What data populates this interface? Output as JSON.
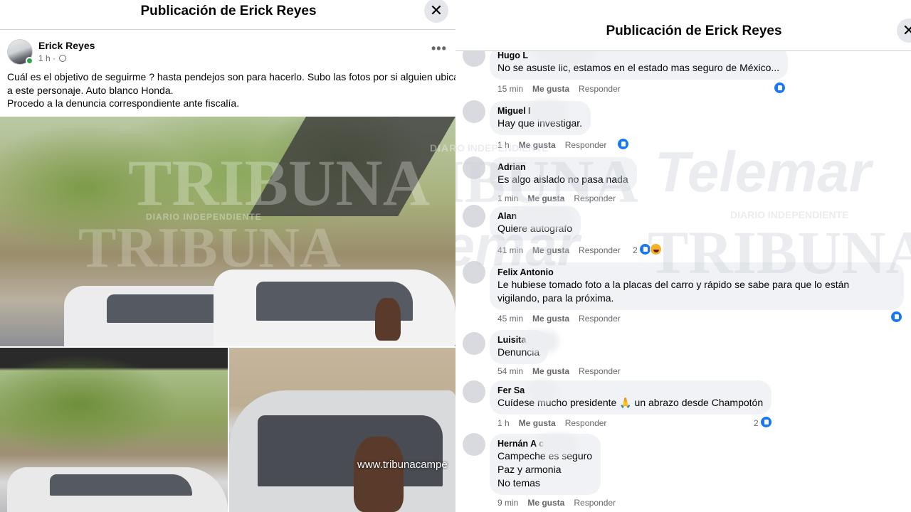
{
  "left_panel": {
    "title": "Publicación de Erick Reyes",
    "close_symbol": "✕",
    "author": "Erick Reyes",
    "time": "1 h",
    "time_separator": "·",
    "more_symbol": "•••",
    "post_lines": [
      "Cuál es el objetivo de seguirme ? hasta pendejos son para hacerlo. Subo las fotos por si alguien ubica",
      "a este personaje. Auto blanco Honda.",
      "Procedo a la denuncia correspondiente ante fiscalía."
    ],
    "watermark_main": "TRIBUNA",
    "watermark_sub": "DIARIO INDEPENDIENTE",
    "watermark_small": "DIARIO INDEPENDIENTE",
    "photo_credit": "www.tribunacampe"
  },
  "right_panel": {
    "title": "Publicación de Erick Reyes",
    "close_symbol": "✕",
    "watermarks": {
      "telemar_1": "Telemar",
      "telemar_2": "Telemar",
      "tribuna_1": "TRIBUNA",
      "tribuna_2": "TRIBUNA",
      "sub_1": "DIARIO INDEPENDIENTE",
      "sub_2": "DIARIO INDEPENDIENTE"
    },
    "comments": [
      {
        "name": "Hugo L",
        "lines": [
          "No se asuste lic, estamos en el estado mas seguro de México..."
        ],
        "time": "15 min",
        "like": "Me gusta",
        "reply": "Responder",
        "reactions": ""
      },
      {
        "name": "Miguel I",
        "lines": [
          "Hay que investigar."
        ],
        "time": "1 h",
        "like": "Me gusta",
        "reply": "Responder",
        "reactions": ""
      },
      {
        "name": "Adrian",
        "lines": [
          "Es algo aislado no pasa nada"
        ],
        "time": "1 min",
        "like": "Me gusta",
        "reply": "Responder",
        "reactions": ""
      },
      {
        "name": "Alan",
        "lines": [
          "Quiere autografo"
        ],
        "time": "41 min",
        "like": "Me gusta",
        "reply": "Responder",
        "reactions": "2"
      },
      {
        "name": "Felix Antonio",
        "lines": [
          "Le hubiese tomado foto a la placas del carro y rápido se sabe para que lo están",
          "vigilando, para la próxima."
        ],
        "time": "45 min",
        "like": "Me gusta",
        "reply": "Responder",
        "reactions": ""
      },
      {
        "name": "Luisita",
        "lines": [
          "Denuncia"
        ],
        "time": "54 min",
        "like": "Me gusta",
        "reply": "Responder",
        "reactions": ""
      },
      {
        "name": "Fer Sa",
        "lines": [
          "Cuídese mucho presidente 🙏 un abrazo desde Champotón"
        ],
        "time": "1 h",
        "like": "Me gusta",
        "reply": "Responder",
        "reactions": "2"
      },
      {
        "name": "Hernán A                c",
        "lines": [
          "Campeche es seguro",
          "Paz y armonia",
          "No temas"
        ],
        "time": "9 min",
        "like": "Me gusta",
        "reply": "Responder",
        "reactions": ""
      }
    ]
  },
  "colors": {
    "facebook_blue": "#1877f2",
    "bubble_bg": "#f0f2f5",
    "meta_gray": "#65676b",
    "online_green": "#31a24c"
  }
}
